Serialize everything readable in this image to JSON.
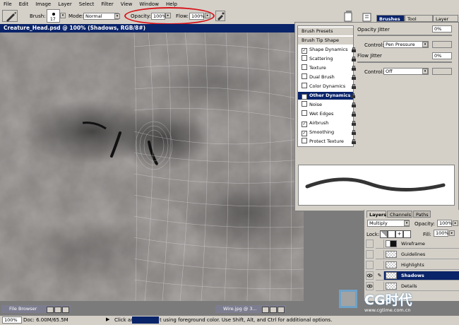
{
  "menu": [
    "File",
    "Edit",
    "Image",
    "Layer",
    "Select",
    "Filter",
    "View",
    "Window",
    "Help"
  ],
  "options": {
    "brush_label": "Brush:",
    "brush_size": "17",
    "mode_label": "Mode:",
    "mode_value": "Normal",
    "opacity_label": "Opacity:",
    "opacity_value": "100%",
    "flow_label": "Flow:",
    "flow_value": "100%"
  },
  "palette_well": {
    "tabs": [
      "Brushes",
      "Tool Presets",
      "Layer Comps"
    ]
  },
  "document": {
    "title": "Creature_Head.psd @ 100% (Shadows, RGB/8#)"
  },
  "brushes": {
    "items": [
      {
        "label": "Brush Presets",
        "checkbox": false,
        "lock": false
      },
      {
        "label": "Brush Tip Shape",
        "checkbox": false,
        "lock": false
      },
      {
        "label": "Shape Dynamics",
        "checkbox": true,
        "checked": true,
        "lock": true
      },
      {
        "label": "Scattering",
        "checkbox": true,
        "checked": false,
        "lock": true
      },
      {
        "label": "Texture",
        "checkbox": true,
        "checked": false,
        "lock": true
      },
      {
        "label": "Dual Brush",
        "checkbox": true,
        "checked": false,
        "lock": true
      },
      {
        "label": "Color Dynamics",
        "checkbox": true,
        "checked": false,
        "lock": true
      },
      {
        "label": "Other Dynamics",
        "checkbox": true,
        "checked": true,
        "lock": true,
        "selected": true
      },
      {
        "label": "Noise",
        "checkbox": true,
        "checked": false,
        "lock": true
      },
      {
        "label": "Wet Edges",
        "checkbox": true,
        "checked": false,
        "lock": true
      },
      {
        "label": "Airbrush",
        "checkbox": true,
        "checked": true,
        "lock": true
      },
      {
        "label": "Smoothing",
        "checkbox": true,
        "checked": true,
        "lock": true
      },
      {
        "label": "Protect Texture",
        "checkbox": true,
        "checked": false,
        "lock": true
      }
    ],
    "opacity_jitter_label": "Opacity Jitter",
    "opacity_jitter_value": "0%",
    "control_label": "Control:",
    "control1_value": "Pen Pressure",
    "flow_jitter_label": "Flow Jitter",
    "flow_jitter_value": "0%",
    "control2_value": "Off"
  },
  "layers": {
    "tabs": [
      "Layers",
      "Channels",
      "Paths"
    ],
    "blend_mode": "Multiply",
    "opacity_label": "Opacity:",
    "opacity_value": "100%",
    "lock_label": "Lock:",
    "fill_label": "Fill:",
    "fill_value": "100%",
    "rows": [
      {
        "name": "Wireframe",
        "visible": false,
        "selected": false,
        "dark_thumb": true
      },
      {
        "name": "Guidelines",
        "visible": false,
        "selected": false,
        "dark_thumb": false
      },
      {
        "name": "Highlights",
        "visible": false,
        "selected": false,
        "dark_thumb": false
      },
      {
        "name": "Shadows",
        "visible": true,
        "selected": true,
        "dark_thumb": false
      },
      {
        "name": "Details",
        "visible": true,
        "selected": false,
        "dark_thumb": false
      }
    ]
  },
  "taskbar": {
    "file_browser": "File Browser",
    "wire_doc": "Wire.jpg @ 3..."
  },
  "status": {
    "zoom": "100%",
    "doc_size": "Doc: 6.00M/65.5M",
    "hint_prefix": "Click an",
    "hint_suffix": "t using foreground color.  Use Shift, Alt, and Ctrl for additional options."
  },
  "watermark": {
    "brand": "CG时代",
    "url": "www.cgtime.com.cn"
  },
  "colors": {
    "highlight": "#0a246a",
    "annotation": "#d8141a"
  }
}
